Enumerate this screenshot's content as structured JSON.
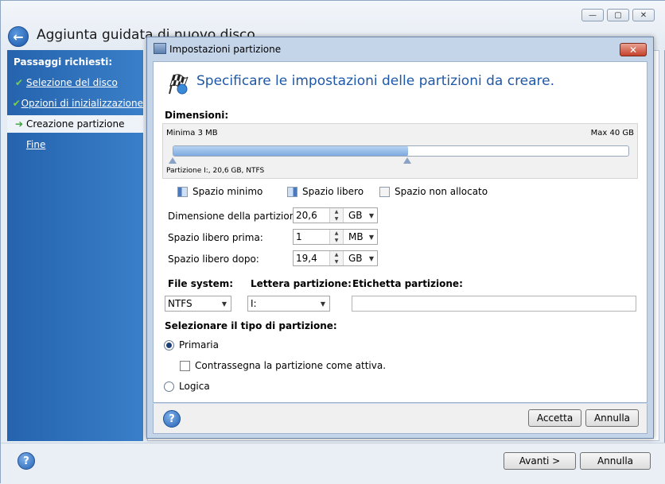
{
  "window": {
    "title": "Aggiunta guidata di nuovo disco",
    "controls": {
      "minimize": "—",
      "maximize": "▢",
      "close": "✕"
    }
  },
  "sidebar": {
    "header": "Passaggi richiesti:",
    "steps": [
      {
        "label": "Selezione del disco",
        "status": "done",
        "icon": "check-icon"
      },
      {
        "label": "Opzioni di inizializzazione",
        "status": "done",
        "icon": "check-icon"
      },
      {
        "label": "Creazione partizione",
        "status": "current",
        "icon": "arrow-right-icon"
      },
      {
        "label": "Fine",
        "status": "pending",
        "icon": ""
      }
    ]
  },
  "footer": {
    "next_label": "Avanti >",
    "cancel_label": "Annulla",
    "help": "?"
  },
  "dialog": {
    "title": "Impostazioni partizione",
    "heading": "Specificare le impostazioni delle partizioni da creare.",
    "dimensions_label": "Dimensioni:",
    "min_label": "Minima 3 MB",
    "max_label": "Max 40 GB",
    "partition_label": "Partizione I:, 20,6 GB, NTFS",
    "slider_fraction": 0.515,
    "legend": {
      "min_space": "Spazio minimo",
      "free_space": "Spazio libero",
      "unallocated": "Spazio non allocato"
    },
    "fields": [
      {
        "label": "Dimensione della partizione:",
        "value": "20,6",
        "unit": "GB"
      },
      {
        "label": "Spazio libero prima:",
        "value": "1",
        "unit": "MB"
      },
      {
        "label": "Spazio libero dopo:",
        "value": "19,4",
        "unit": "GB"
      }
    ],
    "file_system_label": "File system:",
    "file_system_value": "NTFS",
    "letter_label": "Lettera partizione:",
    "letter_value": "I:",
    "volume_label": "Etichetta partizione:",
    "volume_value": "",
    "type_label": "Selezionare il tipo di partizione:",
    "primary_label": "Primaria",
    "primary_selected": true,
    "active_label": "Contrassegna la partizione come attiva.",
    "active_checked": false,
    "logical_label": "Logica",
    "ok_label": "Accetta",
    "cancel_label": "Annulla",
    "help": "?"
  }
}
